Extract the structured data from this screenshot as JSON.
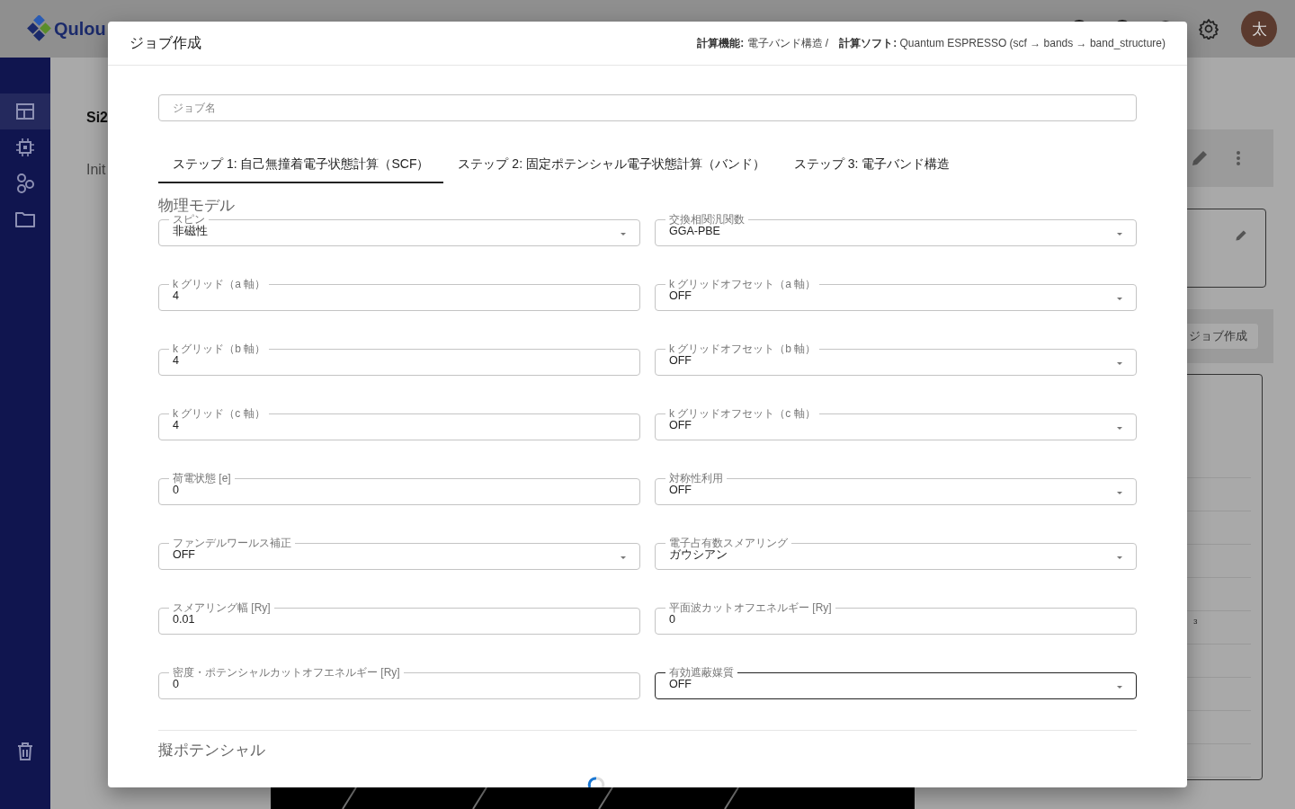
{
  "app_bar": {
    "logo_text": "Qulou",
    "avatar": "太"
  },
  "sidebar": {
    "items": [
      {
        "selected": true
      },
      {
        "selected": false
      },
      {
        "selected": false
      },
      {
        "selected": false
      }
    ]
  },
  "background": {
    "title": "Si2",
    "subtitle": "Init",
    "create_button": "ジョブ作成",
    "superscript": "3"
  },
  "dialog": {
    "title": "ジョブ作成",
    "meta": [
      {
        "label": "計算機能:",
        "value": "電子バンド構造 /"
      },
      {
        "label": "計算ソフト:",
        "value": "Quantum ESPRESSO  (scf → bands → band_structure)"
      }
    ],
    "job_name": {
      "placeholder": "ジョブ名"
    },
    "tabs": [
      {
        "label": "ステップ 1: 自己無撞着電子状態計算（SCF）",
        "selected": true
      },
      {
        "label": "ステップ 2: 固定ポテンシャル電子状態計算（バンド）",
        "selected": false
      },
      {
        "label": "ステップ 3: 電子バンド構造",
        "selected": false
      }
    ],
    "section": "物理モデル",
    "fields": [
      {
        "kind": "select",
        "label": "スピン",
        "value": "非磁性",
        "focused": false
      },
      {
        "kind": "select",
        "label": "交換相関汎関数",
        "value": "GGA-PBE",
        "focused": false
      },
      {
        "kind": "text",
        "label": "k グリッド（a 軸）",
        "value": "4",
        "focused": false
      },
      {
        "kind": "select",
        "label": "k グリッドオフセット（a 軸）",
        "value": "OFF",
        "focused": false
      },
      {
        "kind": "text",
        "label": "k グリッド（b 軸）",
        "value": "4",
        "focused": false
      },
      {
        "kind": "select",
        "label": "k グリッドオフセット（b 軸）",
        "value": "OFF",
        "focused": false
      },
      {
        "kind": "text",
        "label": "k グリッド（c 軸）",
        "value": "4",
        "focused": false
      },
      {
        "kind": "select",
        "label": "k グリッドオフセット（c 軸）",
        "value": "OFF",
        "focused": false
      },
      {
        "kind": "text",
        "label": "荷電状態 [e]",
        "value": "0",
        "focused": false
      },
      {
        "kind": "select",
        "label": "対称性利用",
        "value": "OFF",
        "focused": false
      },
      {
        "kind": "select",
        "label": "ファンデルワールス補正",
        "value": "OFF",
        "focused": false
      },
      {
        "kind": "select",
        "label": "電子占有数スメアリング",
        "value": "ガウシアン",
        "focused": false
      },
      {
        "kind": "text",
        "label": "スメアリング幅 [Ry]",
        "value": "0.01",
        "focused": false
      },
      {
        "kind": "text",
        "label": "平面波カットオフエネルギー [Ry]",
        "value": "0",
        "focused": false
      },
      {
        "kind": "text",
        "label": "密度・ポテンシャルカットオフエネルギー [Ry]",
        "value": "0",
        "focused": false
      },
      {
        "kind": "select",
        "label": "有効遮蔽媒質",
        "value": "OFF",
        "focused": true
      }
    ],
    "section_2": "擬ポテンシャル"
  }
}
